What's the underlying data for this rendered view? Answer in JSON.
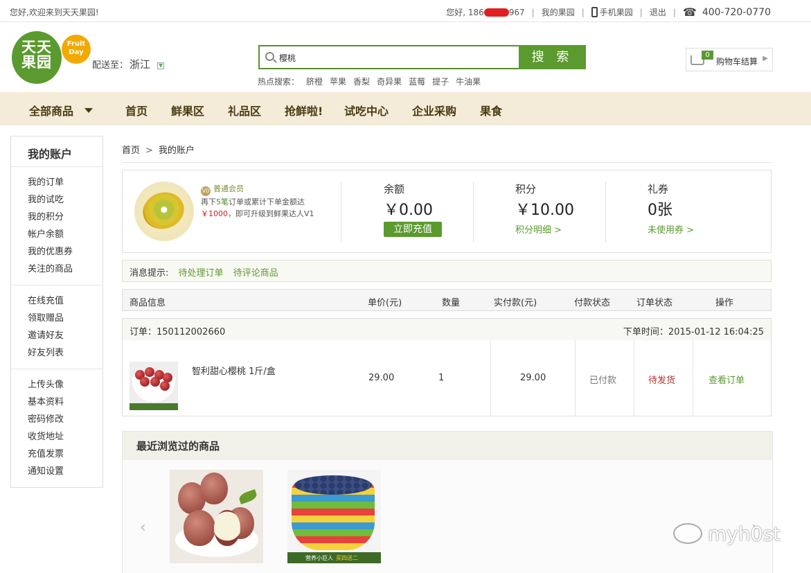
{
  "topbar": {
    "welcome": "您好,欢迎来到天天果园!",
    "greeting": "您好, 186",
    "phone_suffix": "967",
    "my_orchard": "我的果园",
    "mobile_orchard": "手机果园",
    "logout": "退出",
    "tel": "400-720-0770"
  },
  "header": {
    "logo_text_line1": "天天",
    "logo_text_line2": "果园",
    "badge_line1": "Fruit",
    "badge_line2": "Day",
    "ship_label": "配送至：",
    "ship_province": "浙江",
    "search_value": "樱桃",
    "search_button": "搜 索",
    "hot_label": "热点搜索：",
    "hot_keywords": [
      "脐橙",
      "苹果",
      "香梨",
      "奇异果",
      "蓝莓",
      "提子",
      "牛油果"
    ],
    "cart_count": "0",
    "cart_label": "购物车结算"
  },
  "nav": {
    "all_products": "全部商品",
    "items": [
      "首页",
      "鲜果区",
      "礼品区",
      "抢鲜啦!",
      "试吃中心",
      "企业采购",
      "果食"
    ]
  },
  "sidebar": {
    "title": "我的账户",
    "groups": [
      [
        "我的订单",
        "我的试吃",
        "我的积分",
        "帐户余额",
        "我的优惠券",
        "关注的商品"
      ],
      [
        "在线充值",
        "领取赠品",
        "邀请好友",
        "好友列表"
      ],
      [
        "上传头像",
        "基本资料",
        "密码修改",
        "收货地址",
        "充值发票",
        "通知设置"
      ]
    ]
  },
  "breadcrumb": {
    "home": "首页",
    "sep": ">",
    "current": "我的账户"
  },
  "account": {
    "member_badge": "V0",
    "member_level": "普通会员",
    "upgrade_line1_a": "再下",
    "upgrade_line1_b": "5笔",
    "upgrade_line1_c": "订单或累计下单金额达",
    "upgrade_amount": "￥1000",
    "upgrade_line2": "，即可升级到鲜果达人V1",
    "balance_label": "余额",
    "balance_value": "￥0.00",
    "recharge_button": "立即充值",
    "points_label": "积分",
    "points_value": "￥10.00",
    "points_link": "积分明细 >",
    "coupon_label": "礼券",
    "coupon_value": "0张",
    "coupon_link": "未使用券 >"
  },
  "notice": {
    "label": "消息提示:",
    "links": [
      "待处理订单",
      "待评论商品"
    ]
  },
  "table": {
    "headers": [
      "商品信息",
      "单价(元)",
      "数量",
      "实付款(元)",
      "付款状态",
      "订单状态",
      "操作"
    ]
  },
  "order": {
    "number_label": "订单：150112002660",
    "time_label": "下单时间：2015-01-12 16:04:25",
    "product_name": "智利甜心樱桃 1斤/盒",
    "unit_price": "29.00",
    "quantity": "1",
    "paid_amount": "29.00",
    "payment_status": "已付款",
    "order_status": "待发货",
    "action": "查看订单"
  },
  "recent": {
    "title": "最近浏览过的商品",
    "prev": "‹",
    "next": "›",
    "prod2_caption": "营养小巨人",
    "prod2_tag": "买四送二"
  },
  "watermark": {
    "text": "myh0st"
  },
  "colors": {
    "brand_green": "#5a9a2e",
    "nav_bg": "#f4ecd8",
    "status_red": "#b03030",
    "badge_orange": "#f2a900"
  },
  "icons": [
    "search-icon",
    "cart-icon",
    "phone-icon",
    "telephone-icon",
    "dropdown-icon",
    "member-badge-icon"
  ]
}
